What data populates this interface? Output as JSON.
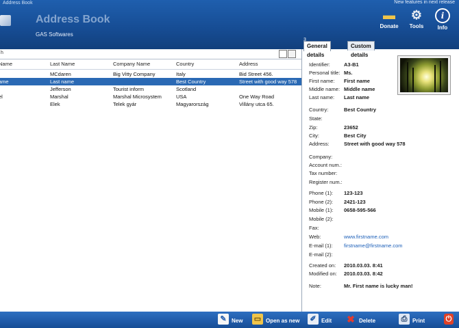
{
  "window": {
    "title": "Address Book"
  },
  "header": {
    "app_title": "Address Book",
    "subtitle": "GAS Softwares",
    "tip": "New features in next release",
    "buttons": {
      "donate": "Donate",
      "tools": "Tools",
      "info": "Info"
    }
  },
  "list": {
    "search_label": "h",
    "columns": [
      "Name",
      "Last Name",
      "Company Name",
      "Country",
      "Address"
    ],
    "rows": [
      {
        "first": "",
        "last": "MCdaren",
        "company": "Big Vitty Company",
        "country": "Italy",
        "address": "Bid Street 456.",
        "selected": false
      },
      {
        "first": "ame",
        "last": "Last name",
        "company": "",
        "country": "Best Country",
        "address": "Street with good way 578",
        "selected": true
      },
      {
        "first": "",
        "last": "Jefferson",
        "company": "Tourist inform",
        "country": "Scotland",
        "address": "",
        "selected": false
      },
      {
        "first": "el",
        "last": "Marshal",
        "company": "Marshal Microsystem",
        "country": "USA",
        "address": "One Way Road",
        "selected": false
      },
      {
        "first": "",
        "last": "Elek",
        "company": "Telek gyár",
        "country": "Magyarország",
        "address": "Villány utca 65.",
        "selected": false
      }
    ]
  },
  "details": {
    "top_id": "3",
    "tabs": [
      "General details",
      "Custom details"
    ],
    "fields": [
      {
        "k": "Identifier:",
        "v": "A3-B1"
      },
      {
        "k": "Personal title:",
        "v": "Ms."
      },
      {
        "k": "First name:",
        "v": "First name"
      },
      {
        "k": "Middle name:",
        "v": "Middle name"
      },
      {
        "k": "Last name:",
        "v": "Last name"
      },
      {
        "k": "Country:",
        "v": "Best Country"
      },
      {
        "k": "State:",
        "v": ""
      },
      {
        "k": "Zip:",
        "v": "23652"
      },
      {
        "k": "City:",
        "v": "Best City"
      },
      {
        "k": "Address:",
        "v": "Street with good way 578"
      },
      {
        "k": "Company:",
        "v": ""
      },
      {
        "k": "Account num.:",
        "v": ""
      },
      {
        "k": "Tax number:",
        "v": ""
      },
      {
        "k": "Register num.:",
        "v": ""
      },
      {
        "k": "Phone (1):",
        "v": "123-123"
      },
      {
        "k": "Phone (2):",
        "v": "2421-123"
      },
      {
        "k": "Mobile (1):",
        "v": "0658-595-566"
      },
      {
        "k": "Mobile (2):",
        "v": ""
      },
      {
        "k": "Fax:",
        "v": ""
      },
      {
        "k": "Web:",
        "v": "www.firstname.com"
      },
      {
        "k": "E-mail (1):",
        "v": "firstname@firstname.com"
      },
      {
        "k": "E-mail (2):",
        "v": ""
      },
      {
        "k": "Created on:",
        "v": "2010.03.03. 8:41"
      },
      {
        "k": "Modified on:",
        "v": "2010.03.03. 8:42"
      },
      {
        "k": "Note:",
        "v": "Mr. First name is lucky man!"
      }
    ]
  },
  "toolbar": {
    "new": "New",
    "open_as_new": "Open as new",
    "edit": "Edit",
    "delete": "Delete",
    "print": "Print"
  }
}
